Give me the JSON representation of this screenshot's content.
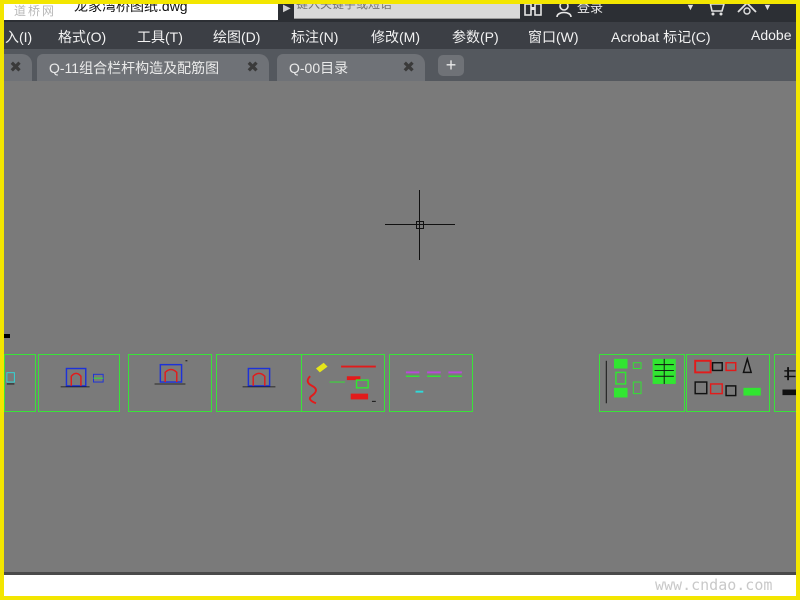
{
  "titlebar": {
    "logo_text": "道桥网",
    "file_name": "龙家湾桥图纸.dwg",
    "search_placeholder": "键入关键字或短语",
    "search_icon": "binoculars-icon",
    "login_label": "登录",
    "user_icon": "user-icon",
    "cart_icon": "cart-icon",
    "help_icon": "help-icon"
  },
  "menu": {
    "items": [
      {
        "label": "入(I)"
      },
      {
        "label": "格式(O)"
      },
      {
        "label": "工具(T)"
      },
      {
        "label": "绘图(D)"
      },
      {
        "label": "标注(N)"
      },
      {
        "label": "修改(M)"
      },
      {
        "label": "参数(P)"
      },
      {
        "label": "窗口(W)"
      },
      {
        "label": "Acrobat 标记(C)"
      },
      {
        "label": "Adobe"
      }
    ]
  },
  "tabs": {
    "items": [
      {
        "label": ""
      },
      {
        "label": "Q-11组合栏杆构造及配筋图"
      },
      {
        "label": "Q-00目录"
      }
    ],
    "close_glyph": "✖",
    "new_tab_glyph": "+"
  },
  "footer": {
    "watermark": "www.cndao.com"
  },
  "colors": {
    "canvas": "#7a7a7a",
    "sheet_border": "#39e339",
    "frame": "#f3e600"
  }
}
